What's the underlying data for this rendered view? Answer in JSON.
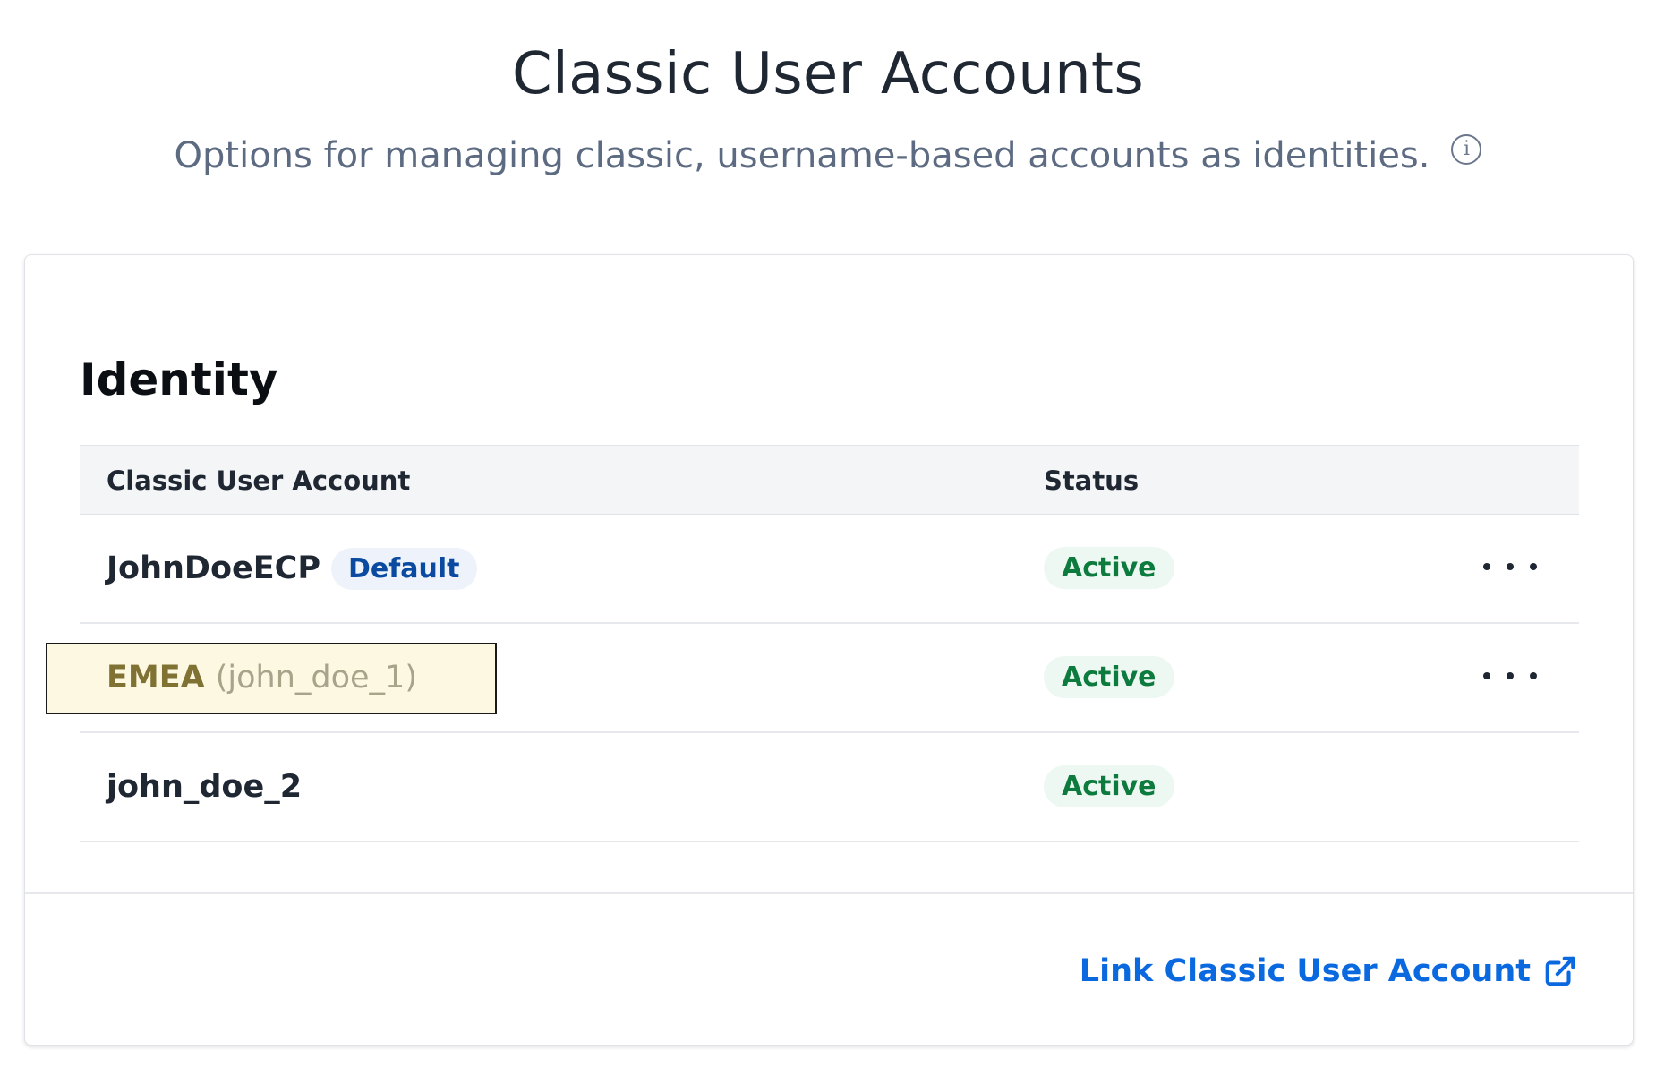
{
  "page": {
    "title": "Classic User Accounts",
    "subtitle": "Options for managing classic, username-based accounts as identities.",
    "info_icon": "info-circle-icon"
  },
  "identity": {
    "heading": "Identity",
    "table": {
      "columns": [
        "Classic User Account",
        "Status"
      ],
      "rows": [
        {
          "name": "JohnDoeECP",
          "badge": "Default",
          "status": "Active",
          "has_menu": true
        },
        {
          "name": "EMEA",
          "subname": "(john_doe_1)",
          "status": "Active",
          "has_menu": true,
          "highlighted": true
        },
        {
          "name": "john_doe_2",
          "status": "Active",
          "has_menu": false
        }
      ]
    },
    "footer": {
      "link_label": "Link Classic User Account",
      "link_icon": "external-link-icon"
    }
  },
  "colors": {
    "link": "#0b69e0",
    "active_badge_text": "#0d7a3e",
    "active_badge_bg": "#eef8f2",
    "default_badge_text": "#0a4aa0",
    "default_badge_bg": "#eef3fb",
    "highlight_bg": "#fdf8e2"
  }
}
